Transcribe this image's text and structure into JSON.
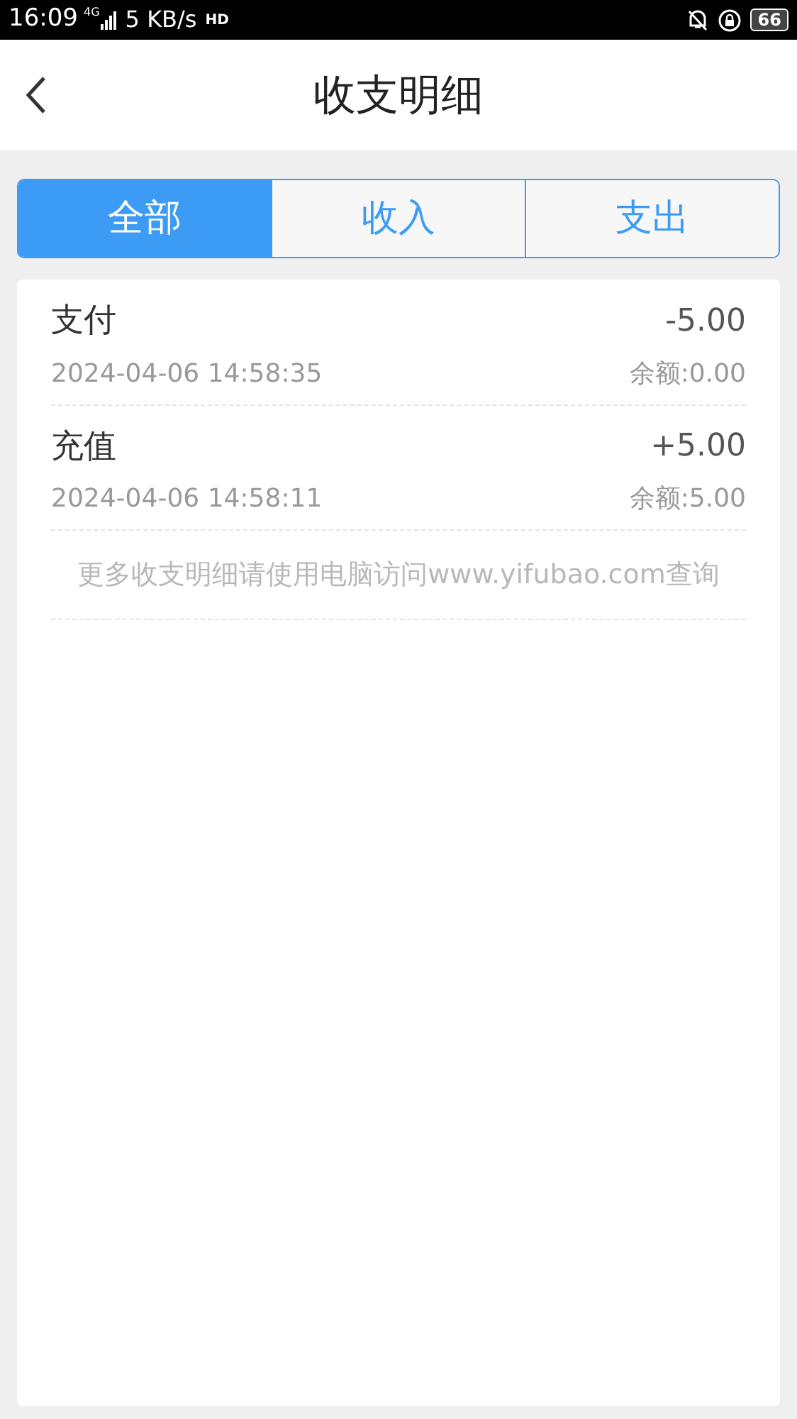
{
  "status_bar": {
    "time": "16:09",
    "network": "4G",
    "speed": "5 KB/s",
    "hd": "HD",
    "battery": "66"
  },
  "header": {
    "title": "收支明细"
  },
  "tabs": [
    {
      "label": "全部",
      "selected": true
    },
    {
      "label": "收入",
      "selected": false
    },
    {
      "label": "支出",
      "selected": false
    }
  ],
  "records": [
    {
      "title": "支付",
      "amount": "-5.00",
      "time": "2024-04-06 14:58:35",
      "balance": "余额:0.00"
    },
    {
      "title": "充值",
      "amount": "+5.00",
      "time": "2024-04-06 14:58:11",
      "balance": "余额:5.00"
    }
  ],
  "footer_note": "更多收支明细请使用电脑访问www.yifubao.com查询"
}
